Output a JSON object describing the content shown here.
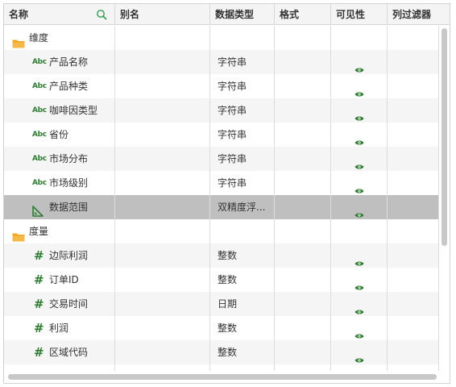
{
  "header": {
    "name": "名称",
    "alias": "别名",
    "data_type": "数据类型",
    "format": "格式",
    "visibility": "可见性",
    "column_filter": "列过滤器"
  },
  "icons": {
    "search": "search-icon",
    "folder": "folder-icon",
    "text_field": "abc-text-icon",
    "number_field": "hash-number-icon",
    "range_field": "ruler-icon",
    "visible": "eye-icon"
  },
  "abc_text": "Abc",
  "hash_text": "#",
  "colors": {
    "accent_green": "#2e7d32",
    "folder_orange": "#f5a623",
    "selected_row": "#bfbfbf",
    "alt_row": "#f5f5f5"
  },
  "rows": [
    {
      "kind": "folder",
      "name": "维度",
      "type": "",
      "visible": false
    },
    {
      "kind": "text",
      "name": "产品名称",
      "type": "字符串",
      "visible": true
    },
    {
      "kind": "text",
      "name": "产品种类",
      "type": "字符串",
      "visible": true
    },
    {
      "kind": "text",
      "name": "咖啡因类型",
      "type": "字符串",
      "visible": true
    },
    {
      "kind": "text",
      "name": "省份",
      "type": "字符串",
      "visible": true
    },
    {
      "kind": "text",
      "name": "市场分布",
      "type": "字符串",
      "visible": true
    },
    {
      "kind": "text",
      "name": "市场级别",
      "type": "字符串",
      "visible": true
    },
    {
      "kind": "range",
      "name": "数据范围",
      "type": "双精度浮...",
      "visible": true,
      "selected": true
    },
    {
      "kind": "folder",
      "name": "度量",
      "type": "",
      "visible": false
    },
    {
      "kind": "number",
      "name": "边际利润",
      "type": "整数",
      "visible": true
    },
    {
      "kind": "number",
      "name": "订单ID",
      "type": "整数",
      "visible": true
    },
    {
      "kind": "number",
      "name": "交易时间",
      "type": "日期",
      "visible": true
    },
    {
      "kind": "number",
      "name": "利润",
      "type": "整数",
      "visible": true
    },
    {
      "kind": "number",
      "name": "区域代码",
      "type": "整数",
      "visible": true
    },
    {
      "kind": "number",
      "name": "",
      "type": "",
      "visible": false
    }
  ]
}
